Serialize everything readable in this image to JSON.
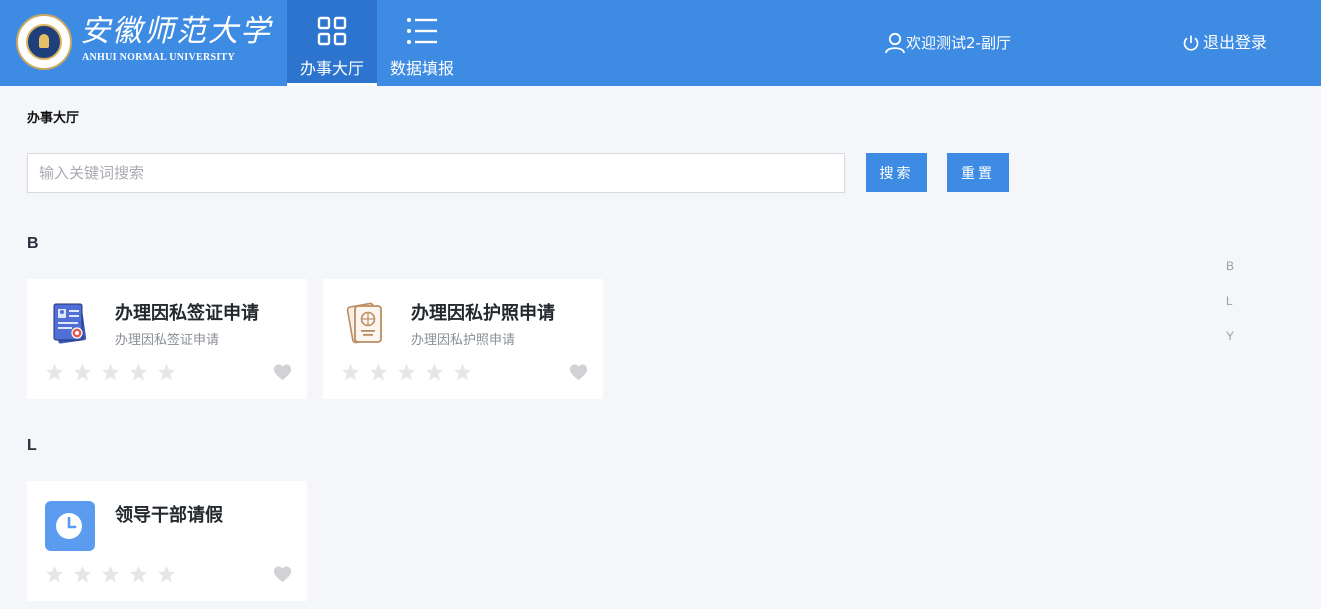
{
  "header": {
    "logo_cn": "安徽师范大学",
    "logo_en": "ANHUI NORMAL UNIVERSITY",
    "nav": [
      {
        "label": "办事大厅",
        "icon": "grid-icon",
        "active": true
      },
      {
        "label": "数据填报",
        "icon": "list-icon",
        "active": false
      }
    ],
    "user_label": "欢迎测试2-副厅",
    "logout_label": "退出登录"
  },
  "page": {
    "title": "办事大厅",
    "search_placeholder": "输入关键词搜索",
    "search_value": "",
    "search_btn": "搜索",
    "reset_btn": "重置"
  },
  "groups": [
    {
      "letter": "B",
      "cards": [
        {
          "title": "办理因私签证申请",
          "subtitle": "办理因私签证申请",
          "icon": "visa-document-icon",
          "rating": 0
        },
        {
          "title": "办理因私护照申请",
          "subtitle": "办理因私护照申请",
          "icon": "passport-icon",
          "rating": 0
        }
      ]
    },
    {
      "letter": "L",
      "cards": [
        {
          "title": "领导干部请假",
          "subtitle": "",
          "icon": "clock-icon",
          "rating": 0
        }
      ]
    }
  ],
  "index_letters": [
    "B",
    "L",
    "Y"
  ],
  "colors": {
    "primary": "#3d8be2",
    "nav_active": "#2d74cf",
    "background": "#f4f6f9",
    "star_empty": "#e5e6e8",
    "heart_empty": "#d0d2d5"
  }
}
